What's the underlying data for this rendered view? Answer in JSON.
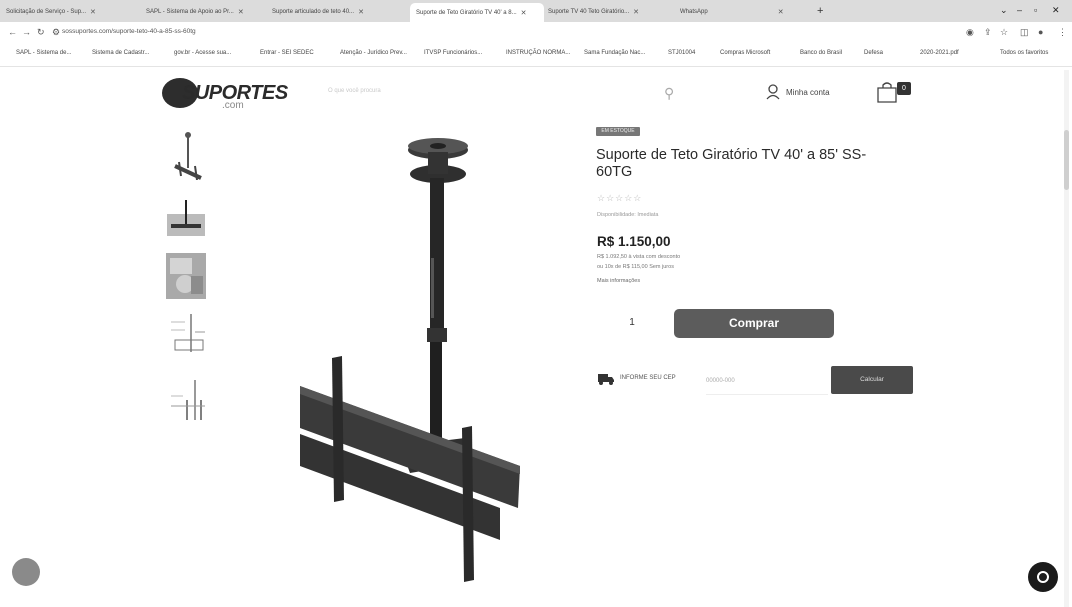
{
  "browser": {
    "tabs": [
      {
        "label": "Solicitação de Serviço - Sup...",
        "active": false
      },
      {
        "label": "SAPL - Sistema de Apoio ao Pr...",
        "active": false
      },
      {
        "label": "Suporte articulado de teto 40...",
        "active": false
      },
      {
        "label": "Suporte de Teto Giratório TV 40' a 8...",
        "active": true
      },
      {
        "label": "Suporte TV 40 Teto Giratório...",
        "active": false
      },
      {
        "label": "WhatsApp",
        "active": false
      }
    ],
    "url": "sossuportes.com/suporte-teto-40-a-85-ss-60tg",
    "bookmarks": [
      "SAPL - Sistema de...",
      "Sistema de Cadastr...",
      "gov.br - Acesse sua...",
      "Entrar - SEI SEDEC",
      "Atenção - Jurídico Prev...",
      "ITVSP Funcionários...",
      "INSTRUÇÃO NORMA...",
      "Sama Fundação Nac...",
      "STJ01004",
      "Compras Microsoft",
      "Banco do Brasil",
      "Defesa",
      "2020-2021.pdf",
      "Todos os favoritos"
    ]
  },
  "header": {
    "logo_text": "SUPORTES",
    "logo_sub": ".com",
    "search_placeholder": "O que você procura",
    "account_label": "Minha conta",
    "cart_count": "0"
  },
  "product": {
    "badge": "EM ESTOQUE",
    "title": "Suporte de Teto Giratório TV 40' a 85' SS-60TG",
    "stars": "☆☆☆☆☆",
    "availability": "Disponibilidade: Imediata",
    "price": "R$ 1.150,00",
    "price_cash": "R$ 1.092,50 à vista com desconto",
    "price_installments": "ou 10x de R$ 115,00 Sem juros",
    "more_info": "Mais informações",
    "quantity": "1",
    "buy_label": "Comprar",
    "cep_label": "INFORME SEU CEP",
    "cep_placeholder": "00000-000",
    "calc_label": "Calcular"
  },
  "colors": {
    "accent": "#5c5c5c",
    "dark": "#2b2b2b"
  }
}
